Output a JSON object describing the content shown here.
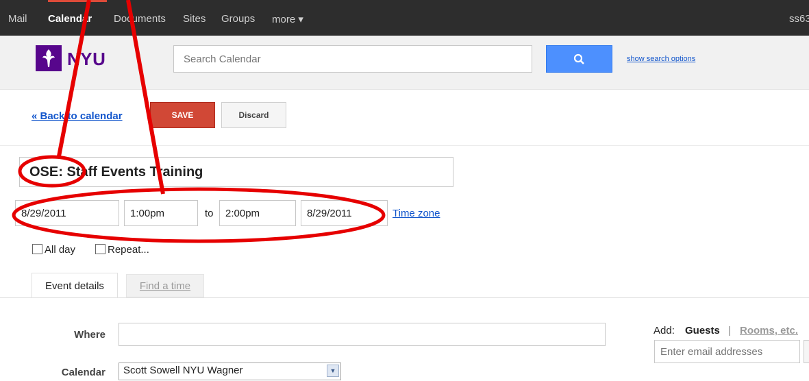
{
  "topbar": {
    "items": [
      {
        "label": "Mail",
        "active": false
      },
      {
        "label": "Calendar",
        "active": true
      },
      {
        "label": "Documents",
        "active": false
      },
      {
        "label": "Sites",
        "active": false
      },
      {
        "label": "Groups",
        "active": false
      },
      {
        "label": "more ▾",
        "active": false
      }
    ],
    "user": "ss63"
  },
  "header": {
    "logo_text": "NYU",
    "search_placeholder": "Search Calendar",
    "search_icon": "search-icon",
    "show_search_options": "show search options"
  },
  "toolbar": {
    "back_label": "« Back to calendar",
    "save_label": "SAVE",
    "discard_label": "Discard"
  },
  "event": {
    "title": "OSE: Staff Events Training",
    "start_date": "8/29/2011",
    "start_time": "1:00pm",
    "to_label": "to",
    "end_time": "2:00pm",
    "end_date": "8/29/2011",
    "time_zone": "Time zone",
    "all_day_label": "All day",
    "repeat_label": "Repeat..."
  },
  "tabs": {
    "details": "Event details",
    "find_time": "Find a time"
  },
  "form": {
    "where_label": "Where",
    "calendar_label": "Calendar",
    "calendar_value": "Scott Sowell NYU Wagner"
  },
  "guests": {
    "add_label": "Add:",
    "guests_label": "Guests",
    "separator": "|",
    "rooms_label": "Rooms, etc.",
    "email_placeholder": "Enter email addresses"
  },
  "colors": {
    "nav_bg": "#2d2d2d",
    "nyu_purple": "#57068c",
    "save_red": "#d14836",
    "search_blue": "#4d90fe",
    "annotation_red": "#e60000",
    "link_blue": "#1155cc"
  }
}
